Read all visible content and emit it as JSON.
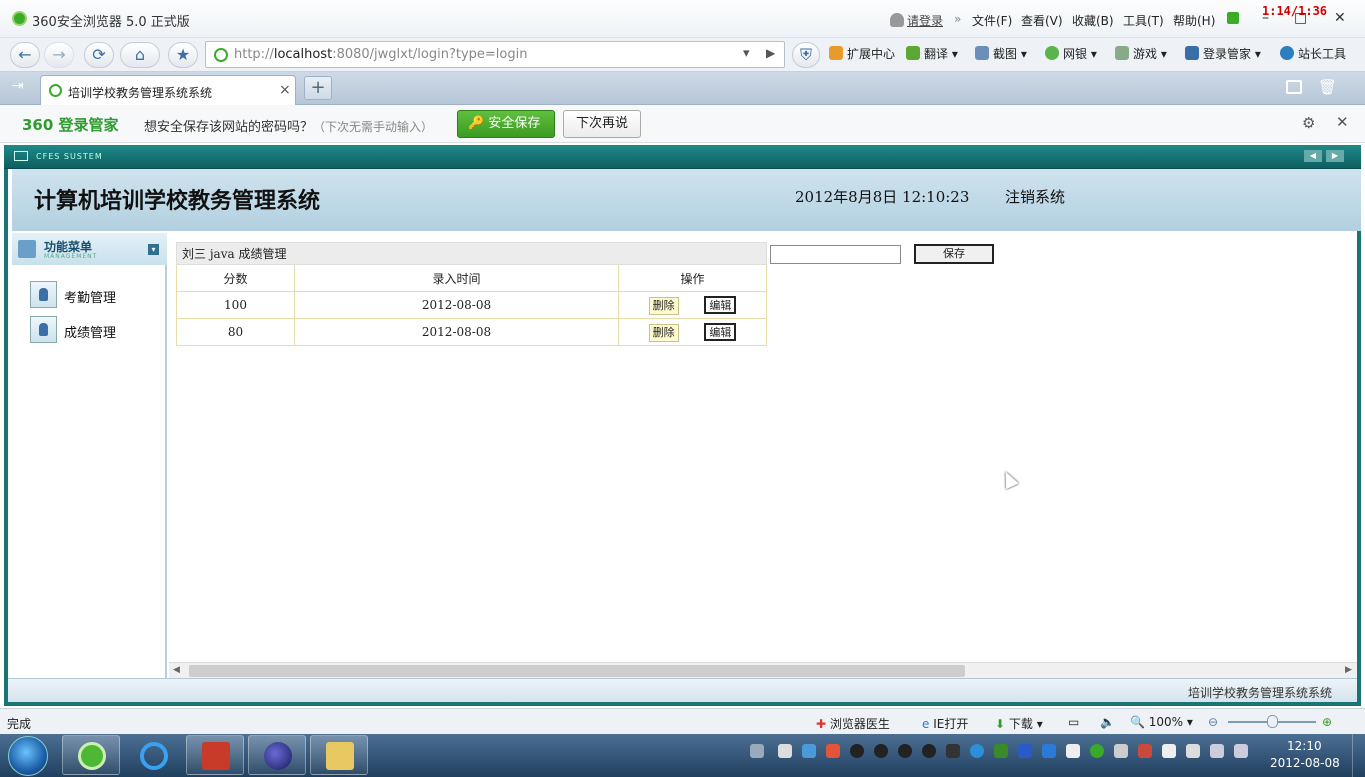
{
  "browser": {
    "title": "360安全浏览器 5.0 正式版",
    "login_link": "请登录",
    "menus": [
      "文件(F)",
      "查看(V)",
      "收藏(B)",
      "工具(T)",
      "帮助(H)"
    ],
    "clock_overlay": "1:14/1:36",
    "url_prefix": "http://",
    "url_host": "localhost",
    "url_rest": ":8080/jwglxt/login?type=login",
    "toolbar": [
      "扩展中心",
      "翻译",
      "截图",
      "网银",
      "游戏",
      "登录管家",
      "站长工具"
    ],
    "tab_title": "培训学校教务管理系统系统",
    "new_tab": "+",
    "close_tab": "×"
  },
  "password_bar": {
    "brand": "360 登录管家",
    "question": "想安全保存该网站的密码吗？",
    "hint": "（下次无需手动输入）",
    "save_label": "安全保存",
    "later_label": "下次再说"
  },
  "page": {
    "sys_label": "CFES SUSTEM",
    "title": "计算机培训学校教务管理系统",
    "datetime": "2012年8月8日  12:10:23",
    "logout": "注销系统",
    "sidebar": {
      "header": "功能菜单",
      "header_sub": "MANAGEMENT",
      "items": [
        {
          "label": "考勤管理"
        },
        {
          "label": "成绩管理"
        }
      ]
    },
    "table": {
      "caption": "刘三 java 成绩管理",
      "headers": [
        "分数",
        "录入时间",
        "操作"
      ],
      "rows": [
        {
          "score": "100",
          "date": "2012-08-08",
          "delete": "删除",
          "edit": "编辑"
        },
        {
          "score": "80",
          "date": "2012-08-08",
          "delete": "删除",
          "edit": "编辑"
        }
      ]
    },
    "score_input_value": "",
    "save_label": "保存",
    "footer": "培训学校教务管理系统系统"
  },
  "statusbar": {
    "status": "完成",
    "items": [
      "浏览器医生",
      "IE打开",
      "下载"
    ],
    "zoom": "100%"
  },
  "taskbar": {
    "time": "12:10",
    "date": "2012-08-08"
  },
  "colors": {
    "accent_green": "#3c9b22",
    "frame_teal": "#1a7474",
    "header_blue": "#b2d0e0"
  }
}
